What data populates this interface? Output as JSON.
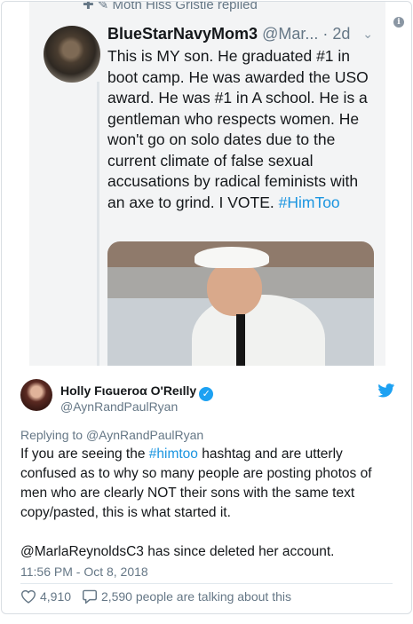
{
  "embedded_tweet": {
    "reply_context": "Moth Hiss Gristle replied",
    "display_name": "BlueStarNavyMom3",
    "handle": "@Mar...",
    "age": "· 2d",
    "text": "This is MY son. He graduated #1 in boot camp. He was awarded the USO award. He was #1 in A school. He is a gentleman who respects women. He won't go on solo dates due to the current climate of false sexual accusations by radical feminists with an axe to grind. I VOTE.",
    "hashtag": "#HimToo"
  },
  "tweet": {
    "display_name": "Holly Fιɢueroα O'Reιlly",
    "handle": "@AynRandPaulRyan",
    "replying_prefix": "Replying to",
    "replying_to": "@AynRandPaulRyan",
    "text_before_tag": "If you are seeing the ",
    "hashtag": "#himtoo",
    "text_after_tag": " hashtag and are utterly confused as to why so many people are posting photos of men who are clearly NOT their sons with the same text copy/pasted, this is what started it.",
    "paragraph2": "@MarlaReynoldsC3 has since deleted her account.",
    "timestamp": "11:56 PM - Oct 8, 2018",
    "likes": "4,910",
    "talking": "2,590 people are talking about this"
  },
  "icons": {
    "info": "info-icon",
    "verified": "verified-badge-icon",
    "twitter": "twitter-bird-icon",
    "like": "heart-icon",
    "comment": "speech-bubble-icon"
  },
  "colors": {
    "link": "#1b95e0",
    "twitter_blue": "#1da1f2",
    "muted": "#657786"
  }
}
